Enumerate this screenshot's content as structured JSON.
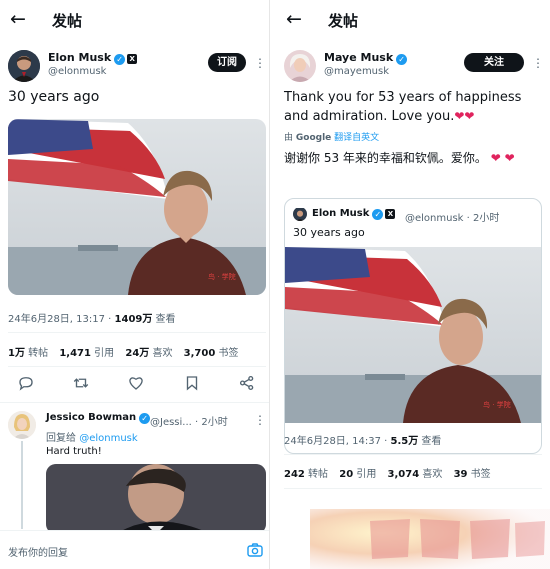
{
  "left": {
    "title": "发帖",
    "post": {
      "author_name": "Elon Musk",
      "handle": "@elonmusk",
      "subscribe_label": "订阅",
      "text": "30 years ago",
      "timestamp": "24年6月28日, 13:17 · ",
      "views": "1409万",
      "views_label": " 查看",
      "stats": [
        {
          "value": "1万",
          "label": " 转帖"
        },
        {
          "value": "1,471",
          "label": " 引用"
        },
        {
          "value": "24万",
          "label": " 喜欢"
        },
        {
          "value": "3,700",
          "label": " 书签"
        }
      ],
      "photo_caption": "30 years ago photo"
    },
    "actions": {
      "reply_icon": "reply-icon",
      "repost_icon": "repost-icon",
      "like_icon": "like-icon",
      "bookmark_icon": "bookmark-icon",
      "share_icon": "share-icon"
    },
    "reply": {
      "author_name": "Jessico Bowman",
      "handle": "@Jessi...",
      "time": "· 2小时",
      "replying_to_label": "回复给 ",
      "replying_to_handle": "@elonmusk",
      "text": "Hard truth!"
    },
    "reply_bar": {
      "placeholder": "发布你的回复"
    }
  },
  "right": {
    "title": "发帖",
    "post": {
      "author_name": "Maye Musk",
      "handle": "@mayemusk",
      "follow_label": "关注",
      "text": "Thank you for 53 years of happiness and admiration. Love you.",
      "translate_prefix": "由 ",
      "translate_google": "Google",
      "translate_link": " 翻译自英文",
      "translated_text": "谢谢你 53 年来的幸福和钦佩。爱你。",
      "timestamp": "24年6月28日, 14:37 · ",
      "views": "5.5万",
      "views_label": " 查看",
      "stats": [
        {
          "value": "242",
          "label": " 转帖"
        },
        {
          "value": "20",
          "label": " 引用"
        },
        {
          "value": "3,074",
          "label": " 喜欢"
        },
        {
          "value": "39",
          "label": " 书签"
        }
      ]
    },
    "quote": {
      "author_name": "Elon Musk",
      "handle": "@elonmusk",
      "time": "· 2小时",
      "text": "30 years ago"
    }
  },
  "colors": {
    "accent": "#1d9bf0",
    "heart": "#e0245e",
    "text": "#0f1419",
    "muted": "#536471"
  }
}
